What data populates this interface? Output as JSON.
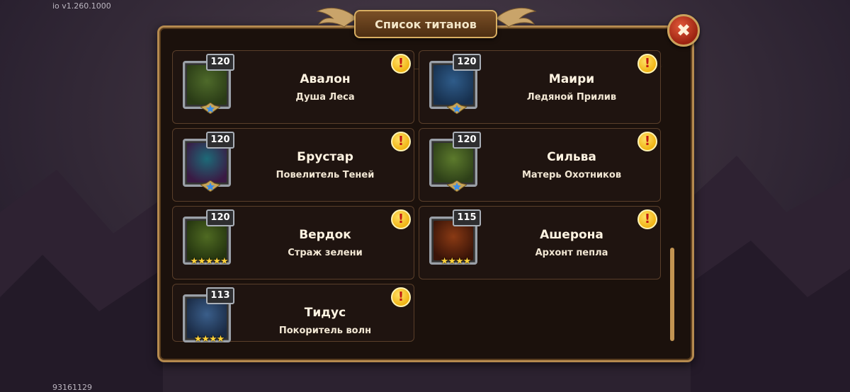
{
  "version": "io v1.260.1000",
  "player_id": "93161129",
  "title": "Список титанов",
  "close_symbol": "✖",
  "alert_symbol": "!",
  "titans": [
    {
      "level": "120",
      "name": "Авалон",
      "subtitle": "Душа Леса",
      "stars": "shield",
      "color1": "#4e6a2a",
      "color2": "#2a3b16"
    },
    {
      "level": "120",
      "name": "Маири",
      "subtitle": "Ледяной Прилив",
      "stars": "shield",
      "color1": "#2f5c8a",
      "color2": "#17304e"
    },
    {
      "level": "120",
      "name": "Брустар",
      "subtitle": "Повелитель Теней",
      "stars": "shield",
      "color1": "#1d6a78",
      "color2": "#3a1a44"
    },
    {
      "level": "120",
      "name": "Сильва",
      "subtitle": "Матерь Охотников",
      "stars": "shield",
      "color1": "#5c7a2c",
      "color2": "#2d3f18"
    },
    {
      "level": "120",
      "name": "Вердок",
      "subtitle": "Страж зелени",
      "stars": "★★★★★",
      "color1": "#4f6a22",
      "color2": "#24340f"
    },
    {
      "level": "115",
      "name": "Ашерона",
      "subtitle": "Архонт пепла",
      "stars": "★★★★",
      "color1": "#8a3a14",
      "color2": "#3a1408"
    },
    {
      "level": "113",
      "name": "Тидус",
      "subtitle": "Покоритель волн",
      "stars": "★★★★",
      "color1": "#3a5e8a",
      "color2": "#1a2a44"
    }
  ]
}
